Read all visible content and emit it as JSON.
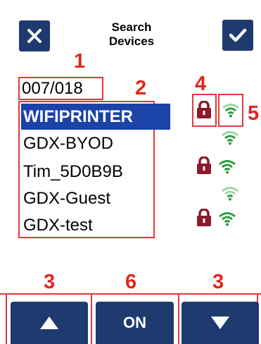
{
  "header": {
    "title_line1": "Search",
    "title_line2": "Devices",
    "cancel_icon": "close-icon",
    "confirm_icon": "check-icon"
  },
  "counter": "007/018",
  "networks": [
    {
      "name": "WIFIPRINTER",
      "selected": true,
      "locked": true
    },
    {
      "name": "GDX-BYOD",
      "selected": false,
      "locked": false
    },
    {
      "name": "Tim_5D0B9B",
      "selected": false,
      "locked": true
    },
    {
      "name": "GDX-Guest",
      "selected": false,
      "locked": false
    },
    {
      "name": "GDX-test",
      "selected": false,
      "locked": true
    }
  ],
  "callouts": {
    "c1": "1",
    "c2": "2",
    "c3_left": "3",
    "c3_right": "3",
    "c4": "4",
    "c5": "5",
    "c6": "6"
  },
  "footer": {
    "up_icon": "arrow-up-icon",
    "toggle_label": "ON",
    "down_icon": "arrow-down-icon"
  },
  "colors": {
    "button_bg": "#1f3a6e",
    "selection_bg": "#1b43a8",
    "callout_red": "#e2261c",
    "lock_red": "#8b1a2b",
    "wifi_green": "#2e9b3c",
    "wifi_light": "#9ed39f"
  }
}
